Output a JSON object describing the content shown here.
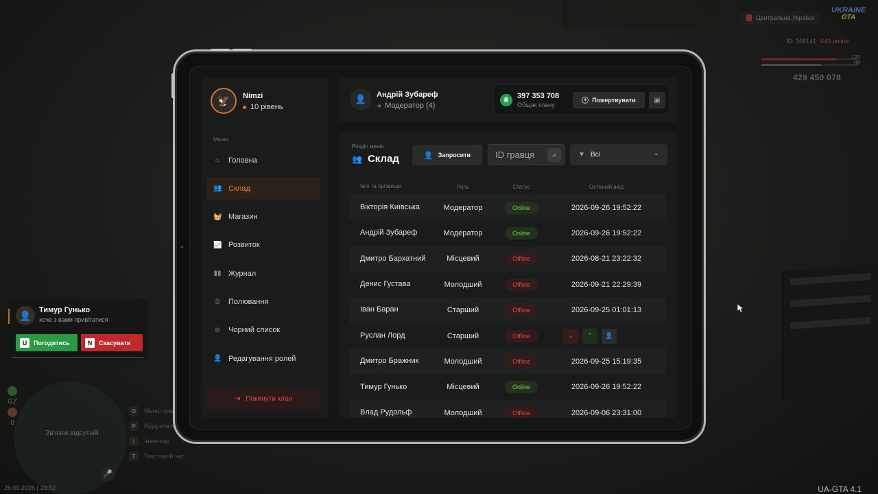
{
  "hud": {
    "region": "Центральна Україна",
    "logo_top": "UKRAINE",
    "logo_bottom": "GTA",
    "id_label": "ID: 168141",
    "online": "643 online",
    "health": "125",
    "armor": "88",
    "money": "429 450 078"
  },
  "popup": {
    "name": "Тимур Гунько",
    "message": "хоче з вами привітатися",
    "accept_key": "U",
    "accept_label": "Погодитись",
    "cancel_key": "N",
    "cancel_label": "Скасувати"
  },
  "hud_bottom": {
    "gz": "GZ",
    "zero": "0",
    "minimap_text": "Зв'язок відсутній",
    "hotkeys": [
      {
        "key": "O",
        "label": "Меню гравця"
      },
      {
        "key": "P",
        "label": "Відкрити планшет"
      },
      {
        "key": "I",
        "label": "Інвентар"
      },
      {
        "key": "T",
        "label": "Текстовий чат"
      }
    ],
    "datetime": "26.09.2026 | 19:52",
    "version": "UA-GTA 4.1"
  },
  "profile": {
    "name": "Nimzi",
    "level": "10 рівень"
  },
  "menu": {
    "caption": "Меню",
    "items": [
      {
        "label": "Головна",
        "icon": "home-icon"
      },
      {
        "label": "Склад",
        "icon": "members-icon"
      },
      {
        "label": "Магазин",
        "icon": "shop-icon"
      },
      {
        "label": "Розвиток",
        "icon": "chart-icon"
      },
      {
        "label": "Журнал",
        "icon": "book-icon"
      },
      {
        "label": "Полювання",
        "icon": "target-icon"
      },
      {
        "label": "Чорний список",
        "icon": "block-icon"
      },
      {
        "label": "Редагування ролей",
        "icon": "role-icon"
      }
    ],
    "active_index": 1,
    "leave_label": "Покинути клан"
  },
  "user": {
    "name": "Андрій Зубареф",
    "role": "Модератор (4)"
  },
  "fund": {
    "amount": "397 353 708",
    "label": "Общак клану",
    "donate_label": "Пожертвувати"
  },
  "section": {
    "caption": "Розділ меню",
    "title": "Склад",
    "invite_label": "Запросити",
    "search_placeholder": "ID гравця",
    "filter_value": "Всі"
  },
  "table": {
    "headers": [
      "Ім'я та прізвище",
      "Роль",
      "Статус",
      "Останній вхід"
    ],
    "rows": [
      {
        "name": "Вікторія Київська",
        "role": "Модератор",
        "status": "Online",
        "last": "2026-09-26 19:52:22"
      },
      {
        "name": "Андрій Зубареф",
        "role": "Модератор",
        "status": "Online",
        "last": "2026-09-26 19:52:22"
      },
      {
        "name": "Дмитро Бархатний",
        "role": "Місцевий",
        "status": "Offline",
        "last": "2026-08-21 23:22:32"
      },
      {
        "name": "Денис Густава",
        "role": "Молодший",
        "status": "Offline",
        "last": "2026-09-21 22:29:39"
      },
      {
        "name": "Іван Баран",
        "role": "Старший",
        "status": "Offline",
        "last": "2026-09-25 01:01:13"
      },
      {
        "name": "Руслан Лорд",
        "role": "Старший",
        "status": "Offline",
        "last": ""
      },
      {
        "name": "Дмитро Бражник",
        "role": "Молодший",
        "status": "Offline",
        "last": "2026-09-25 15:19:35"
      },
      {
        "name": "Тимур Гунько",
        "role": "Місцевий",
        "status": "Online",
        "last": "2026-09-26 19:52:22"
      },
      {
        "name": "Влад Рудольф",
        "role": "Молодший",
        "status": "Offline",
        "last": "2026-09-06 23:31:00"
      }
    ]
  },
  "colors": {
    "accent": "#e8802a",
    "online": "#7bcf3f",
    "offline": "#d84a3c"
  }
}
